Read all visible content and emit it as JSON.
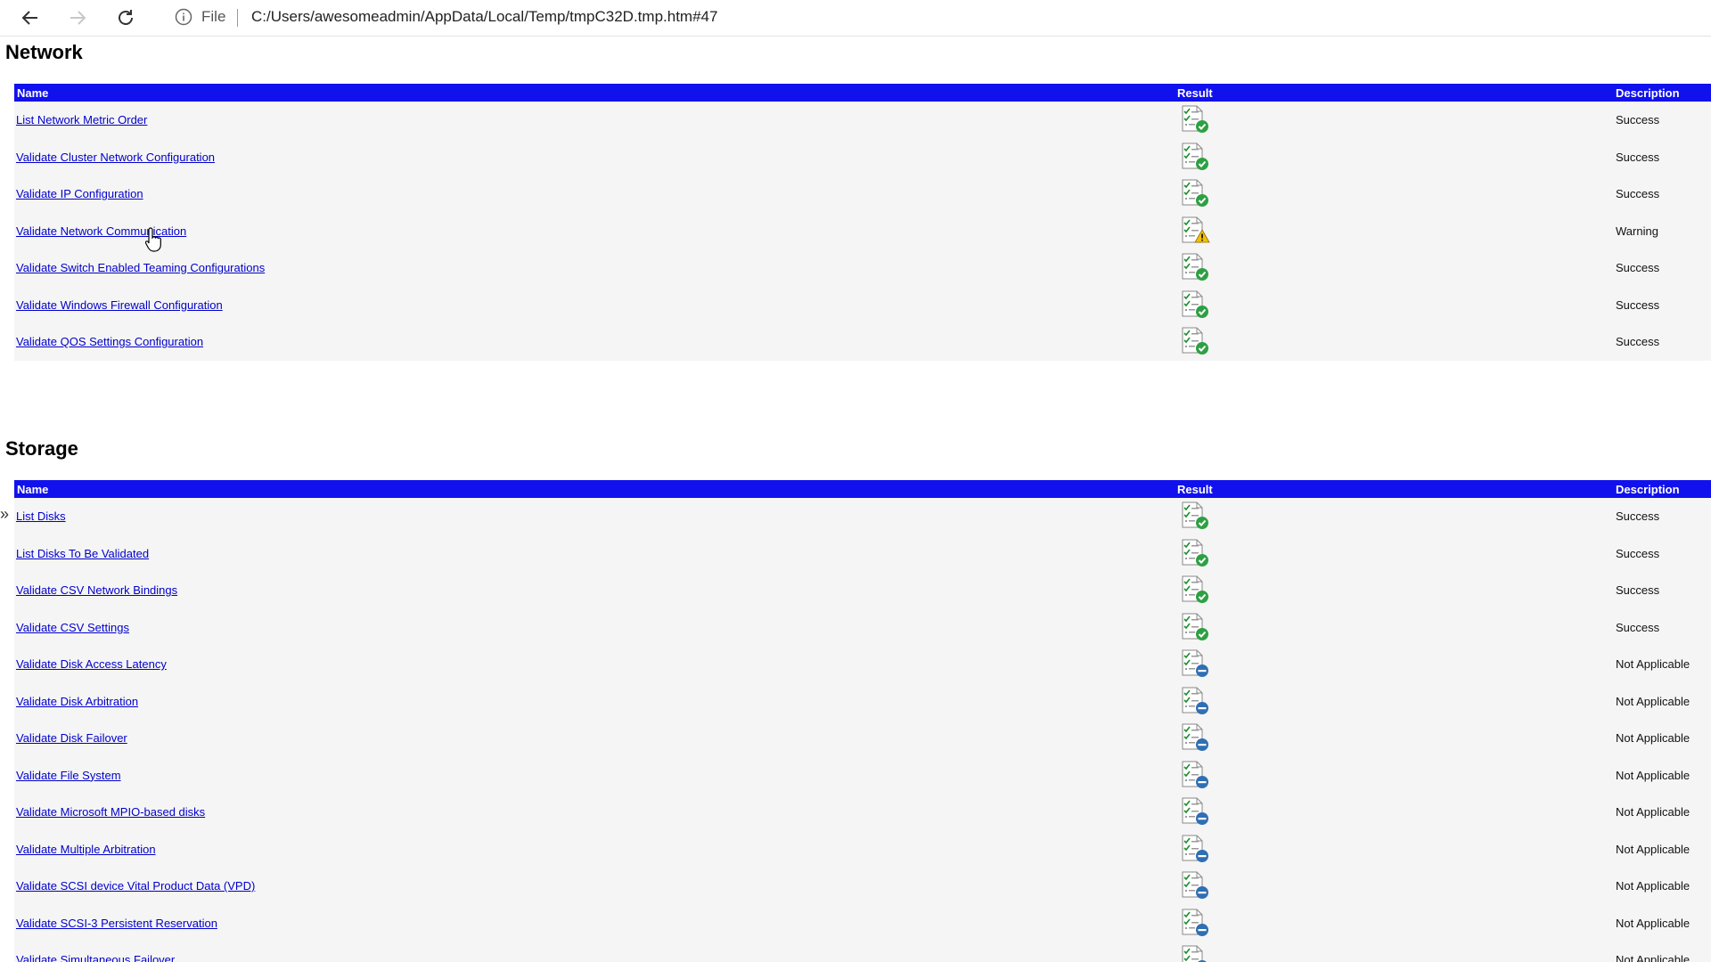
{
  "browser": {
    "file_label": "File",
    "url": "C:/Users/awesomeadmin/AppData/Local/Temp/tmpC32D.tmp.htm#47"
  },
  "columns": {
    "name": "Name",
    "result": "Result",
    "description": "Description"
  },
  "network": {
    "title": "Network",
    "rows": [
      {
        "name": "List Network Metric Order",
        "status": "success",
        "desc": "Success"
      },
      {
        "name": "Validate Cluster Network Configuration",
        "status": "success",
        "desc": "Success"
      },
      {
        "name": "Validate IP Configuration",
        "status": "success",
        "desc": "Success"
      },
      {
        "name": "Validate Network Communication",
        "status": "warning",
        "desc": "Warning"
      },
      {
        "name": "Validate Switch Enabled Teaming Configurations",
        "status": "success",
        "desc": "Success"
      },
      {
        "name": "Validate Windows Firewall Configuration",
        "status": "success",
        "desc": "Success"
      },
      {
        "name": "Validate QOS Settings Configuration",
        "status": "success",
        "desc": "Success"
      }
    ]
  },
  "storage": {
    "title": "Storage",
    "rows": [
      {
        "name": "List Disks",
        "status": "success",
        "desc": "Success"
      },
      {
        "name": "List Disks To Be Validated",
        "status": "success",
        "desc": "Success"
      },
      {
        "name": "Validate CSV Network Bindings",
        "status": "success",
        "desc": "Success"
      },
      {
        "name": "Validate CSV Settings",
        "status": "success",
        "desc": "Success"
      },
      {
        "name": "Validate Disk Access Latency",
        "status": "na",
        "desc": "Not Applicable"
      },
      {
        "name": "Validate Disk Arbitration",
        "status": "na",
        "desc": "Not Applicable"
      },
      {
        "name": "Validate Disk Failover",
        "status": "na",
        "desc": "Not Applicable"
      },
      {
        "name": "Validate File System",
        "status": "na",
        "desc": "Not Applicable"
      },
      {
        "name": "Validate Microsoft MPIO-based disks",
        "status": "na",
        "desc": "Not Applicable"
      },
      {
        "name": "Validate Multiple Arbitration",
        "status": "na",
        "desc": "Not Applicable"
      },
      {
        "name": "Validate SCSI device Vital Product Data (VPD)",
        "status": "na",
        "desc": "Not Applicable"
      },
      {
        "name": "Validate SCSI-3 Persistent Reservation",
        "status": "na",
        "desc": "Not Applicable"
      },
      {
        "name": "Validate Simultaneous Failover",
        "status": "na",
        "desc": "Not Applicable"
      }
    ]
  },
  "icons": {
    "back": "back-arrow-icon",
    "forward": "forward-arrow-icon",
    "reload": "reload-icon",
    "info": "info-icon",
    "success": "report-check-icon",
    "warning": "report-warning-icon",
    "na": "report-not-applicable-icon"
  },
  "colors": {
    "header_bar": "#1111ee",
    "link": "#0000cc",
    "success": "#2ea043",
    "warning": "#f2c200",
    "na": "#2f6fb4"
  }
}
